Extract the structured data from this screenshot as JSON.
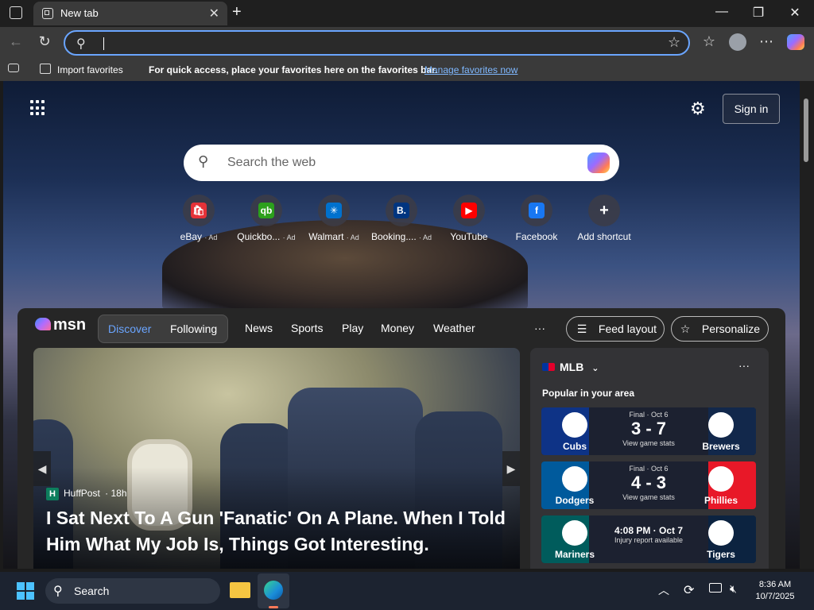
{
  "browser": {
    "tab_title": "New tab",
    "address_value": "",
    "favorites_bar": {
      "import_label": "Import favorites",
      "message": "For quick access, place your favorites here on the favorites bar.",
      "manage_link": "Manage favorites now"
    }
  },
  "newtab": {
    "sign_in": "Sign in",
    "search_placeholder": "Search the web",
    "shortcuts": [
      {
        "name": "eBay",
        "ad": "· Ad",
        "icon": "ebay-icon",
        "color": "#e53238"
      },
      {
        "name": "Quickbo...",
        "ad": "· Ad",
        "icon": "quickbooks-icon",
        "color": "#2ca01c"
      },
      {
        "name": "Walmart",
        "ad": "· Ad",
        "icon": "walmart-icon",
        "color": "#0071ce"
      },
      {
        "name": "Booking....",
        "ad": "· Ad",
        "icon": "booking-icon",
        "color": "#003580"
      },
      {
        "name": "YouTube",
        "ad": "",
        "icon": "youtube-icon",
        "color": "#ff0000"
      },
      {
        "name": "Facebook",
        "ad": "",
        "icon": "facebook-icon",
        "color": "#1877f2"
      },
      {
        "name": "Add shortcut",
        "ad": "",
        "icon": "plus-icon",
        "color": "#555555"
      }
    ]
  },
  "feed": {
    "logo_text": "msn",
    "tabs": [
      "Discover",
      "Following"
    ],
    "nav": [
      "News",
      "Sports",
      "Play",
      "Money",
      "Weather"
    ],
    "more": "···",
    "feed_layout": "Feed layout",
    "personalize": "Personalize",
    "hero": {
      "source": "HuffPost",
      "age": "· 18h",
      "title": "I Sat Next To A Gun 'Fanatic' On A Plane. When I Told Him What My Job Is, Things Got Interesting."
    },
    "mlb": {
      "title": "MLB",
      "subtitle": "Popular in your area",
      "games": [
        {
          "status": "Final · Oct 6",
          "score": "3 - 7",
          "link": "View game stats",
          "away": "Cubs",
          "home": "Brewers",
          "away_color": "#0e3386",
          "home_color": "#12284b"
        },
        {
          "status": "Final · Oct 6",
          "score": "4 - 3",
          "link": "View game stats",
          "away": "Dodgers",
          "home": "Phillies",
          "away_color": "#005a9c",
          "home_color": "#e81828"
        },
        {
          "status": "4:08 PM · Oct 7",
          "score": "",
          "link": "Injury report available",
          "away": "Mariners",
          "home": "Tigers",
          "away_color": "#005c5c",
          "home_color": "#0c2340"
        }
      ]
    }
  },
  "taskbar": {
    "search": "Search",
    "time": "8:36 AM",
    "date": "10/7/2025"
  }
}
